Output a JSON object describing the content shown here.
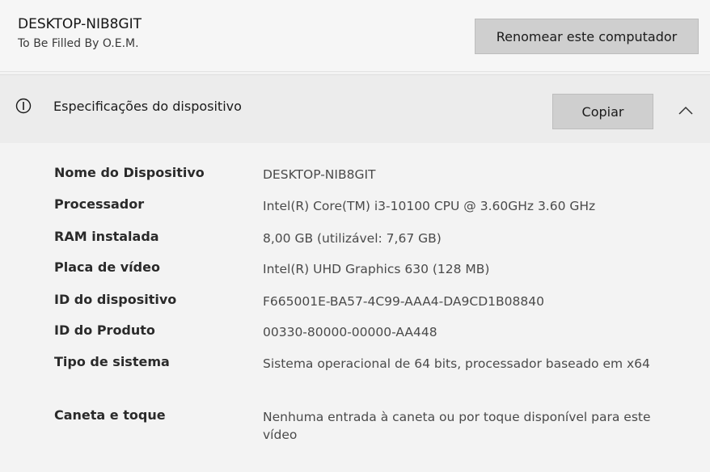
{
  "header": {
    "device_name": "DESKTOP-NIB8GIT",
    "device_model": "To Be Filled By O.E.M.",
    "rename_label": "Renomear este computador"
  },
  "specs": {
    "title": "Especificações do dispositivo",
    "copy_label": "Copiar",
    "icons": {
      "section": "info-icon",
      "toggle": "chevron-up-icon"
    },
    "rows": [
      {
        "label": "Nome do Dispositivo",
        "value": "DESKTOP-NIB8GIT"
      },
      {
        "label": "Processador",
        "value": "Intel(R) Core(TM) i3-10100 CPU @ 3.60GHz   3.60 GHz"
      },
      {
        "label": "RAM instalada",
        "value": "8,00 GB (utilizável: 7,67 GB)"
      },
      {
        "label": "Placa de vídeo",
        "value": "Intel(R) UHD Graphics 630 (128 MB)"
      },
      {
        "label": "ID do dispositivo",
        "value": "F665001E-BA57-4C99-AAA4-DA9CD1B08840"
      },
      {
        "label": "ID do Produto",
        "value": "00330-80000-00000-AA448"
      },
      {
        "label": "Tipo de sistema",
        "value": "Sistema operacional de 64 bits, processador baseado em x64"
      },
      {
        "label": "Caneta e toque",
        "value": "Nenhuma entrada à caneta ou por toque disponível para este vídeo"
      }
    ]
  }
}
